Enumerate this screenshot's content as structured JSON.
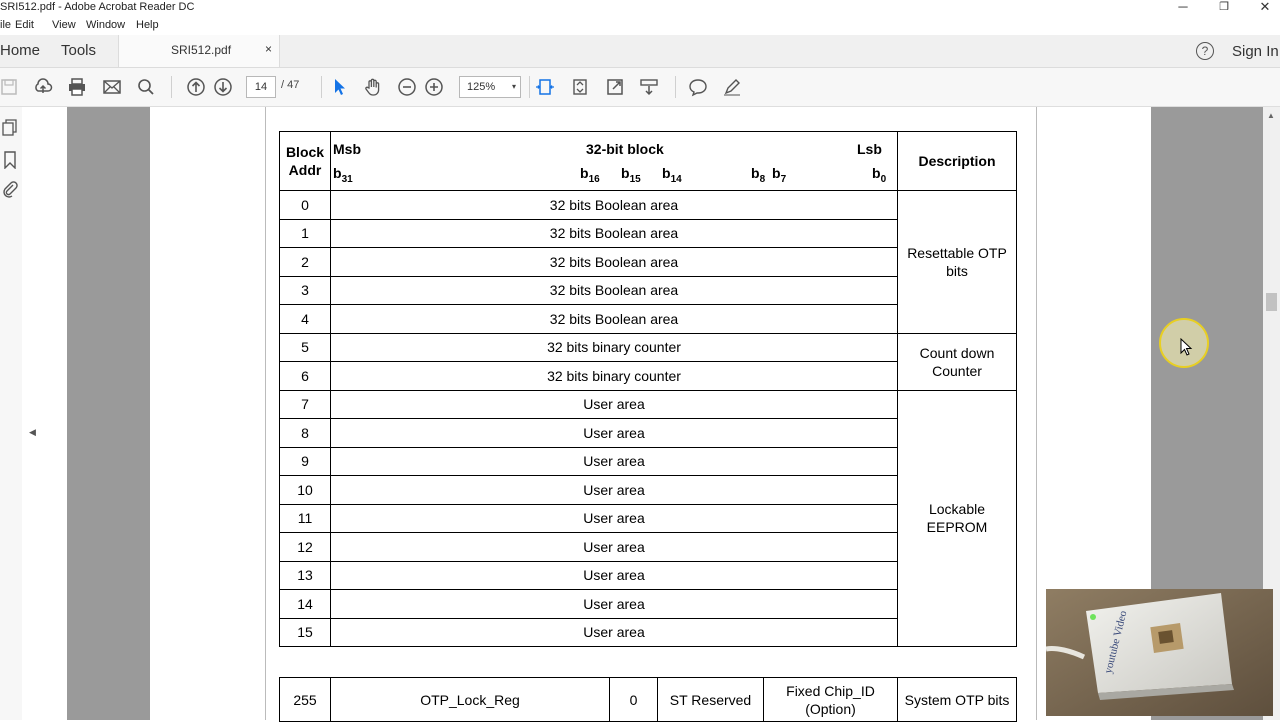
{
  "window": {
    "title": "SRI512.pdf - Adobe Acrobat Reader DC",
    "minimize": "─",
    "maximize": "❐",
    "close": "✕"
  },
  "menu": [
    "ile",
    "Edit",
    "View",
    "Window",
    "Help"
  ],
  "tabs": {
    "home": "Home",
    "tools": "Tools",
    "document": "SRI512.pdf",
    "close": "×",
    "help": "?",
    "signin": "Sign In"
  },
  "toolbar": {
    "page_current": "14",
    "page_total": "/ 47",
    "zoom": "125%",
    "zoom_caret": "▾"
  },
  "table": {
    "header": {
      "col1": [
        "Block",
        "Addr"
      ],
      "msb": "Msb",
      "title": "32-bit block",
      "lsb": "Lsb",
      "description": "Description",
      "bit_labels": [
        {
          "base": "b",
          "sub": "31"
        },
        {
          "base": "b",
          "sub": "16"
        },
        {
          "base": "b",
          "sub": "15"
        },
        {
          "base": "b",
          "sub": "14"
        },
        {
          "base": "b",
          "sub": "8"
        },
        {
          "base": "b",
          "sub": "7"
        },
        {
          "base": "b",
          "sub": "0"
        }
      ]
    },
    "rows": [
      {
        "addr": "0",
        "content": "32 bits Boolean area"
      },
      {
        "addr": "1",
        "content": "32 bits Boolean area"
      },
      {
        "addr": "2",
        "content": "32 bits Boolean area"
      },
      {
        "addr": "3",
        "content": "32 bits Boolean area"
      },
      {
        "addr": "4",
        "content": "32 bits Boolean area"
      },
      {
        "addr": "5",
        "content": "32 bits binary counter"
      },
      {
        "addr": "6",
        "content": "32 bits binary counter"
      },
      {
        "addr": "7",
        "content": "User area"
      },
      {
        "addr": "8",
        "content": "User area"
      },
      {
        "addr": "9",
        "content": "User area"
      },
      {
        "addr": "10",
        "content": "User area"
      },
      {
        "addr": "11",
        "content": "User area"
      },
      {
        "addr": "12",
        "content": "User area"
      },
      {
        "addr": "13",
        "content": "User area"
      },
      {
        "addr": "14",
        "content": "User area"
      },
      {
        "addr": "15",
        "content": "User area"
      }
    ],
    "groups": [
      {
        "text": "Resettable OTP bits"
      },
      {
        "text": "Count down Counter"
      },
      {
        "text": "Lockable EEPROM"
      }
    ],
    "system_row": {
      "addr": "255",
      "reg": "OTP_Lock_Reg",
      "bit": "0",
      "reserved": "ST Reserved",
      "chip_id": [
        "Fixed Chip_ID",
        "(Option)"
      ],
      "description": "System OTP bits"
    }
  }
}
